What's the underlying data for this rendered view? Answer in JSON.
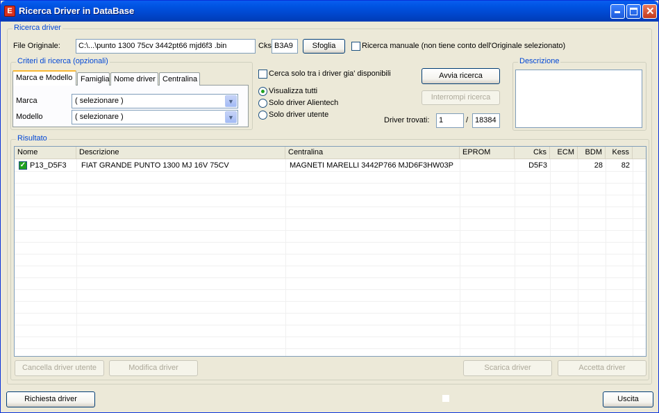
{
  "window": {
    "title": "Ricerca Driver in DataBase",
    "icon_letter": "E"
  },
  "ricerca": {
    "group_title": "Ricerca driver",
    "file_label": "File Originale:",
    "file_value": "C:\\...\\punto 1300 75cv 3442pt66 mjd6f3 .bin",
    "cks_label": "Cks",
    "cks_value": "B3A9",
    "sfoglia": "Sfoglia",
    "manual_label": "Ricerca manuale (non tiene conto dell'Originale selezionato)"
  },
  "criteri": {
    "group_title": "Criteri di ricerca (opzionali)",
    "tabs": [
      "Marca e Modello",
      "Famiglia",
      "Nome driver",
      "Centralina"
    ],
    "marca_label": "Marca",
    "marca_value": "( selezionare )",
    "modello_label": "Modello",
    "modello_value": "( selezionare )"
  },
  "options": {
    "only_available": "Cerca solo tra i driver gia' disponibili",
    "radios": [
      "Visualizza tutti",
      "Solo driver Alientech",
      "Solo driver utente"
    ],
    "avvia": "Avvia ricerca",
    "interrompi": "Interrompi ricerca",
    "trovati_label": "Driver trovati:",
    "trovati_count": "1",
    "separator": "/",
    "trovati_total": "18384"
  },
  "descrizione": {
    "group_title": "Descrizione"
  },
  "risultato": {
    "group_title": "Risultato",
    "columns": [
      "Nome",
      "Descrizione",
      "Centralina",
      "EPROM",
      "Cks",
      "ECM",
      "BDM",
      "Kess"
    ],
    "rows": [
      {
        "nome": "P13_D5F3",
        "descrizione": "FIAT GRANDE PUNTO 1300 MJ 16V  75CV",
        "centralina": "MAGNETI MARELLI 3442P766 MJD6F3HW03P",
        "eprom": "",
        "cks": "D5F3",
        "ecm": "",
        "bdm": "28",
        "kess": "82",
        "checked": true
      }
    ]
  },
  "actions": {
    "cancella": "Cancella driver utente",
    "modifica": "Modifica driver",
    "scarica": "Scarica driver",
    "accetta": "Accetta driver",
    "richiesta": "Richiesta driver",
    "uscita": "Uscita"
  }
}
